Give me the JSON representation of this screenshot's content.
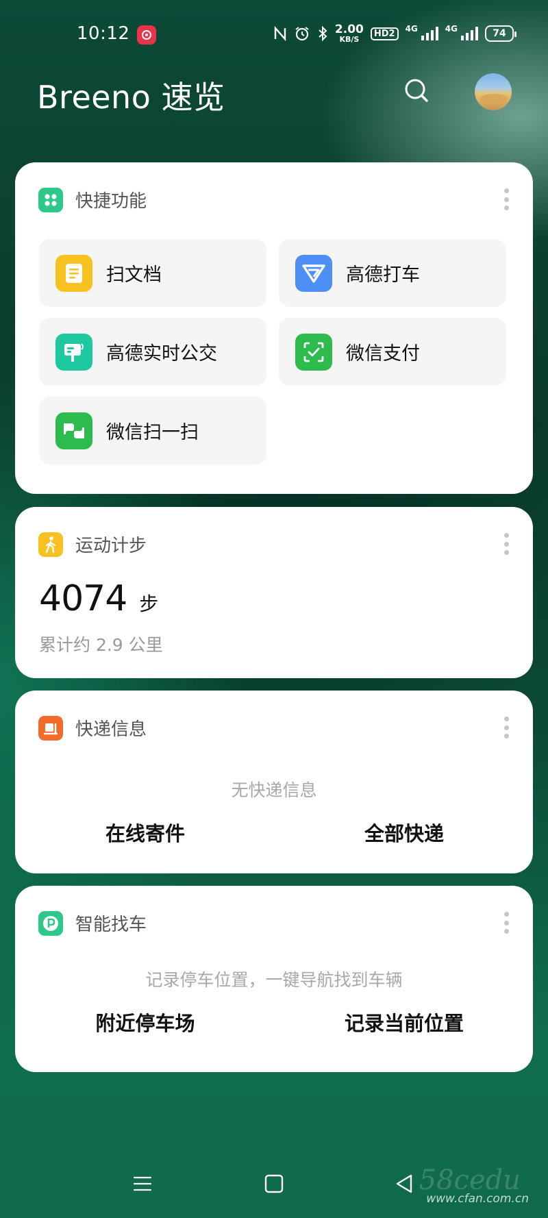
{
  "status_bar": {
    "time": "10:12",
    "net_speed_value": "2.00",
    "net_speed_unit": "KB/S",
    "hd_badge": "HD2",
    "sim1_network": "4G",
    "sim2_network": "4G",
    "battery_level": "74"
  },
  "header": {
    "title": "Breeno 速览"
  },
  "quick_card": {
    "title": "快捷功能",
    "shortcuts": [
      {
        "label": "扫文档",
        "icon": "document-scan-icon",
        "color": "#f7c21f"
      },
      {
        "label": "高德打车",
        "icon": "amap-taxi-icon",
        "color": "#4d8ff5"
      },
      {
        "label": "高德实时公交",
        "icon": "bus-stop-icon",
        "color": "#1fc9a0"
      },
      {
        "label": "微信支付",
        "icon": "wechat-pay-icon",
        "color": "#2dbb4e"
      },
      {
        "label": "微信扫一扫",
        "icon": "wechat-scan-icon",
        "color": "#2dbb4e"
      }
    ]
  },
  "steps_card": {
    "title": "运动计步",
    "count": "4074",
    "unit": "步",
    "distance_text": "累计约 2.9 公里",
    "icon_color": "#f7c21f"
  },
  "express_card": {
    "title": "快递信息",
    "empty_text": "无快递信息",
    "action_left": "在线寄件",
    "action_right": "全部快递",
    "icon_color": "#f26d2b"
  },
  "parking_card": {
    "title": "智能找车",
    "hint_text": "记录停车位置，一键导航找到车辆",
    "action_left": "附近停车场",
    "action_right": "记录当前位置",
    "icon_color": "#2ec98a"
  },
  "watermark": {
    "text": "www.cfan.com.cn",
    "big_text": "58cedu"
  }
}
